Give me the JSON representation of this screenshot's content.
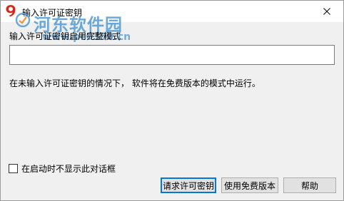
{
  "window": {
    "title": "输入许可证密钥"
  },
  "watermark": {
    "site_name": "河东软件园",
    "url": "www.pc0359.cn"
  },
  "main": {
    "prompt": "输入许可证密钥启用完整模式",
    "license_key_value": "",
    "info": "在未输入许可证密钥的情况下， 软件将在免费版本的模式中运行。"
  },
  "footer": {
    "checkbox_label": "在启动时不显示此对话框",
    "checkbox_checked": false,
    "buttons": {
      "request": "请求许可密钥",
      "free": "使用免费版本",
      "help": "帮助"
    }
  },
  "colors": {
    "accent": "#0078d7",
    "app_icon": "#e0231a",
    "watermark": "#4a96d2"
  }
}
